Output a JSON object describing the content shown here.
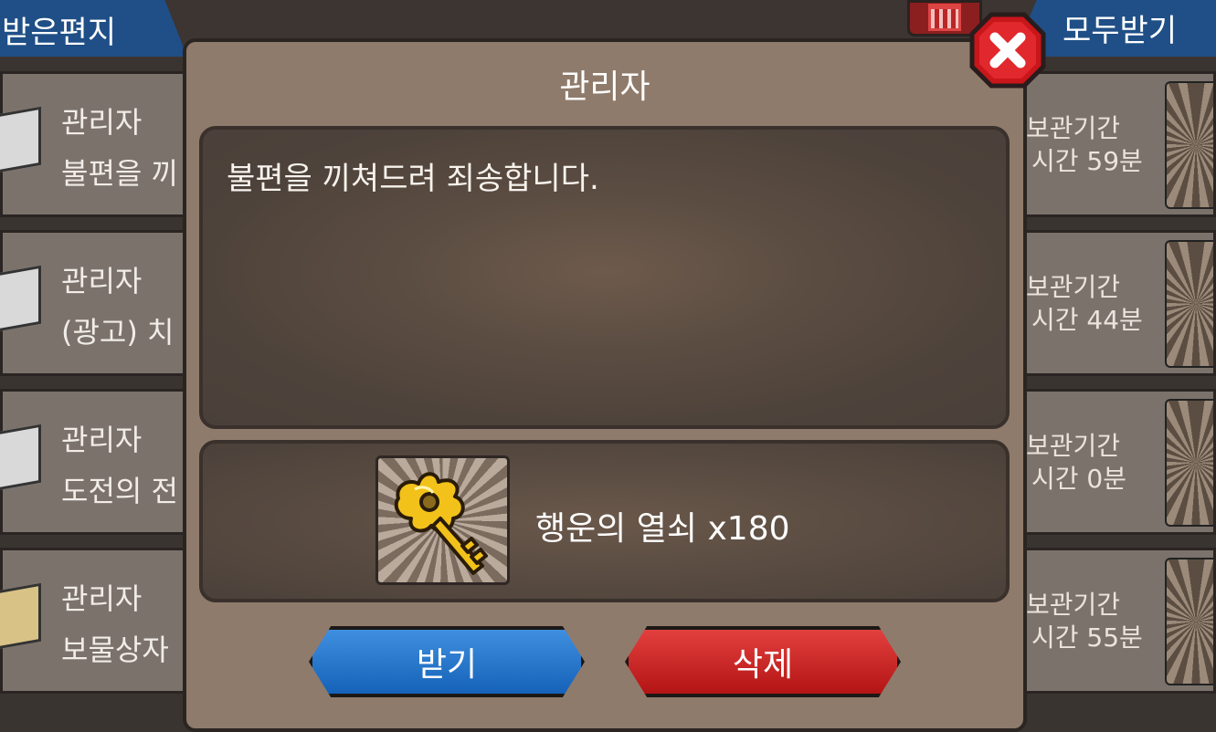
{
  "header": {
    "received_tab": "받은편지",
    "receive_all_button": "모두받기"
  },
  "mail_list": [
    {
      "sender": "관리자",
      "title": "불편을 끼",
      "envelope": "white"
    },
    {
      "sender": "관리자",
      "title": "(광고) 치",
      "envelope": "white"
    },
    {
      "sender": "관리자",
      "title": "도전의 전",
      "envelope": "white"
    },
    {
      "sender": "관리자",
      "title": "보물상자",
      "envelope": "gold"
    }
  ],
  "right_list": [
    {
      "line1": "보관기간",
      "line2": "시간 59분"
    },
    {
      "line1": "보관기간",
      "line2": "시간 44분"
    },
    {
      "line1": "보관기간",
      "line2": "시간 0분"
    },
    {
      "line1": "보관기간",
      "line2": "시간 55분"
    }
  ],
  "dialog": {
    "title": "관리자",
    "message": "불편을 끼쳐드려 죄송합니다.",
    "reward_text": "행운의 열쇠 x180",
    "reward_icon": "golden-key-icon",
    "receive_button": "받기",
    "delete_button": "삭제",
    "close_icon": "close-x-icon"
  },
  "colors": {
    "blue_button": "#1f6fc4",
    "red_button": "#c81c1c",
    "dialog_bg": "#8f7b6b"
  }
}
